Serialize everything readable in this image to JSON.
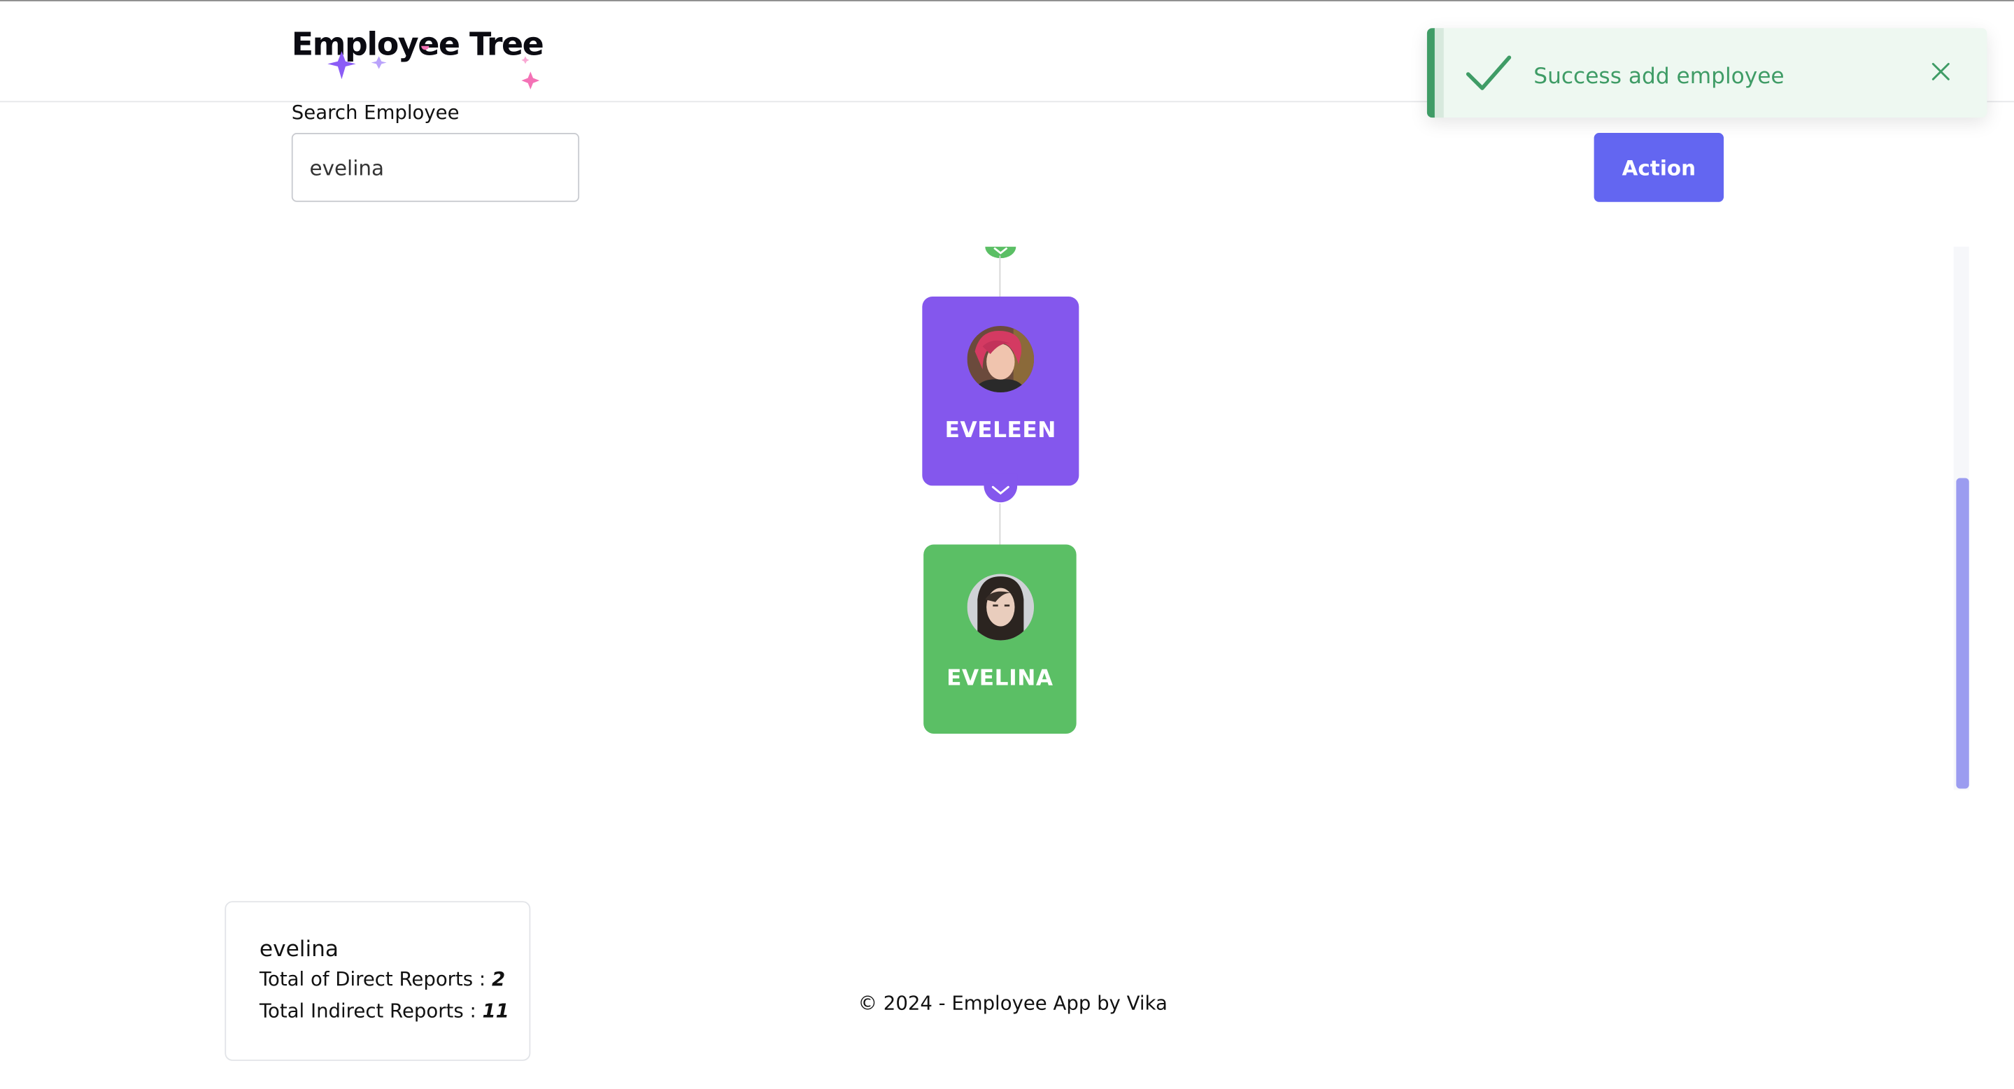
{
  "header": {
    "brand": "Employee Tree"
  },
  "search": {
    "label": "Search Employee",
    "value": "evelina",
    "placeholder": ""
  },
  "toolbar": {
    "action_label": "Action"
  },
  "toast": {
    "message": "Success add employee",
    "accent": "#3f9c66",
    "background": "#eef8f1"
  },
  "tree": {
    "nodes": [
      {
        "name": "EVELEEN",
        "color": "#8457ed"
      },
      {
        "name": "EVELINA",
        "color": "#5bbf65"
      }
    ]
  },
  "info": {
    "name": "evelina",
    "direct_label": "Total of Direct Reports :",
    "direct_value": "2",
    "indirect_label": "Total Indirect Reports :",
    "indirect_value": "11"
  },
  "footer": {
    "text": "© 2024 - Employee App by Vika"
  },
  "colors": {
    "primary": "#6366f1",
    "scroll_thumb": "#9b9cf0"
  }
}
